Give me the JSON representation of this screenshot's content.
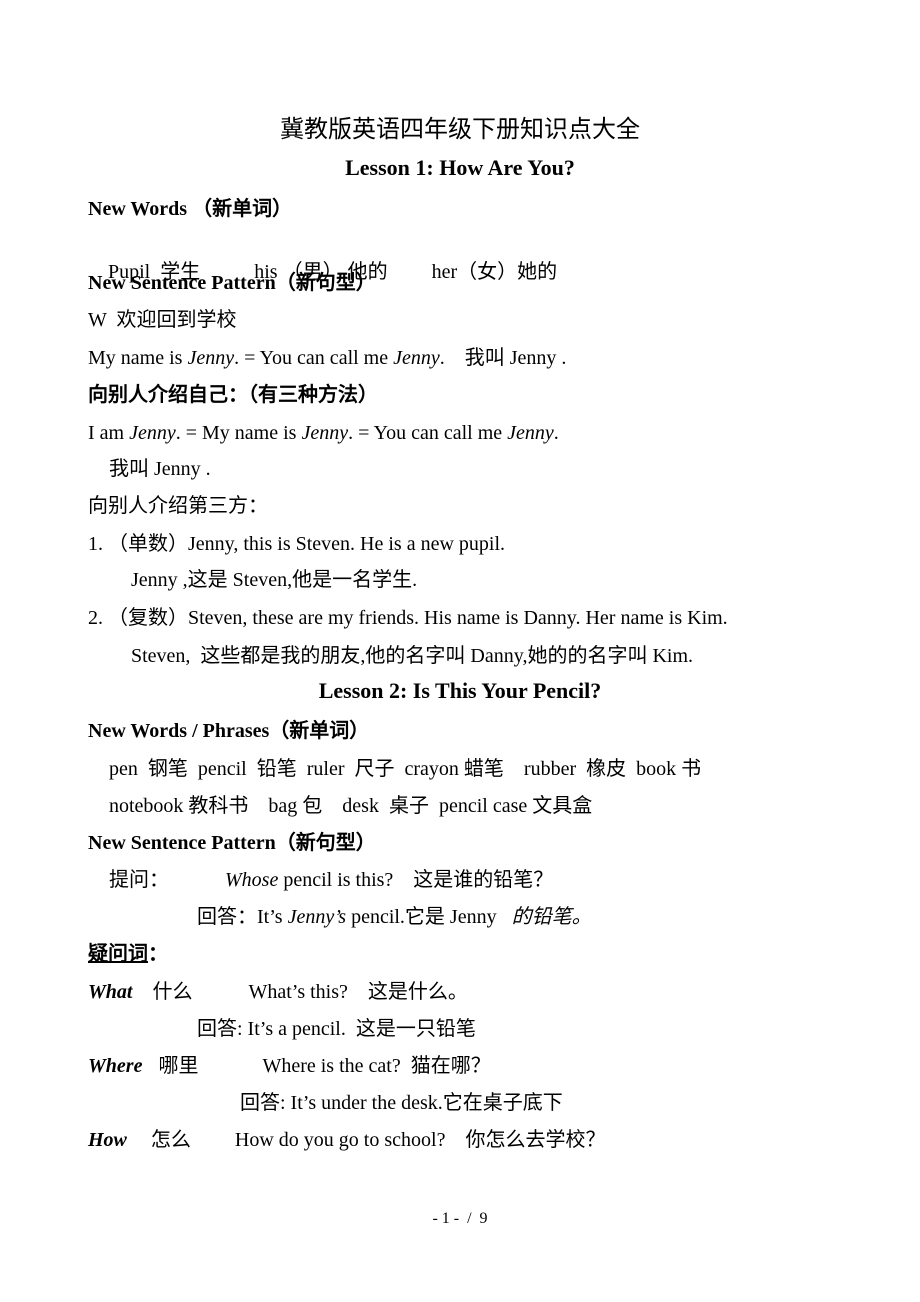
{
  "document": {
    "title": "冀教版英语四年级下册知识点大全",
    "lesson1": {
      "heading": "Lesson 1: How Are You?",
      "new_words_label": "New Words （新单词）",
      "words": {
        "w1": "Pupil  学生",
        "w2": "his （男） 他的",
        "w3": "her（女）她的"
      },
      "sentence_pattern_label": "New Sentence Pattern（新句型）",
      "welcome": "W  欢迎回到学校",
      "line_myname": {
        "a": "My name is ",
        "b": "Jenny",
        "c": ". = You can call me ",
        "d": "Jenny",
        "e": ".    我叫 Jenny ."
      },
      "intro_self_label": "向别人介绍自己：（有三种方法）",
      "line_iam": {
        "a": "I am ",
        "b": "Jenny",
        "c": ". = My name is ",
        "d": "Jenny",
        "e": ". = You can call me ",
        "f": "Jenny",
        "g": "."
      },
      "line_iam_cn": "我叫 Jenny .",
      "intro_third_label": "向别人介绍第三方：",
      "item1": "1. （单数）Jenny, this is Steven. He is a new pupil.",
      "item1_cn": "Jenny ,这是 Steven,他是一名学生.",
      "item2": "2. （复数）Steven, these are my friends. His name is Danny. Her name is Kim.",
      "item2_cn": "Steven,  这些都是我的朋友,他的名字叫 Danny,她的的名字叫 Kim."
    },
    "lesson2": {
      "heading": "Lesson 2: Is This Your Pencil?",
      "new_words_label": "New Words / Phrases（新单词）",
      "words_line1": "pen  钢笔  pencil  铅笔  ruler  尺子  crayon 蜡笔    rubber  橡皮  book 书",
      "words_line2": "notebook 教科书    bag 包    desk  桌子  pencil case 文具盒",
      "sentence_pattern_label": "New Sentence Pattern（新句型）",
      "question_label": "提问：",
      "question_italic": "Whose",
      "question_rest": " pencil is this?    这是谁的铅笔？",
      "answer_label": "回答：It’s ",
      "answer_italic": "Jenny’s",
      "answer_rest": " pencil.它是 Jenny   ",
      "answer_tail_italic": "的铅笔。",
      "qwords_label": "疑问词",
      "qwords_colon": "：",
      "what_word": "What",
      "what_cn": "什么",
      "what_example": "What’s this?    这是什么。",
      "what_answer": "回答: It’s a pencil.  这是一只铅笔",
      "where_word": "Where",
      "where_cn": "哪里",
      "where_example": "Where is the cat?  猫在哪？",
      "where_answer": "回答: It’s under the desk.它在桌子底下",
      "how_word": "How",
      "how_cn": "怎么",
      "how_example": "How do you go to school?    你怎么去学校？"
    },
    "footer": {
      "page_indicator": "- 1 -  /  9"
    }
  }
}
